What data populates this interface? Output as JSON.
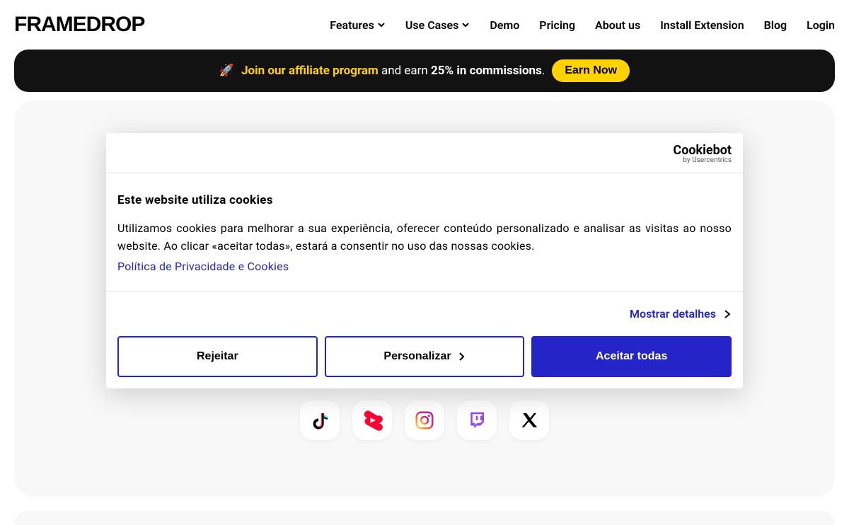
{
  "header": {
    "logo": "FRAMEDROP",
    "nav": {
      "features": "Features",
      "usecases": "Use Cases",
      "demo": "Demo",
      "pricing": "Pricing",
      "about": "About us",
      "install": "Install Extension",
      "blog": "Blog",
      "login": "Login"
    }
  },
  "banner": {
    "rocket": "🚀",
    "link": "Join our affiliate program",
    "mid1": " and earn ",
    "bold": "25% in commissions",
    "dot": ".",
    "cta": "Earn Now"
  },
  "cookiebot": {
    "brand": "Cookiebot",
    "byline": "by Usercentrics"
  },
  "cookie": {
    "title": "Este website utiliza cookies",
    "body": "Utilizamos cookies para melhorar a sua experiência, oferecer conteúdo personalizado e analisar as visitas ao nosso website. Ao clicar «aceitar todas», estará a consentir no uso das nossas cookies.",
    "policy": "Política de Privacidade e Cookies",
    "showDetails": "Mostrar detalhes",
    "reject": "Rejeitar",
    "customize": "Personalizar",
    "accept": "Aceitar todas"
  },
  "colors": {
    "primary": "#2424c8",
    "accent": "#ffd200"
  }
}
